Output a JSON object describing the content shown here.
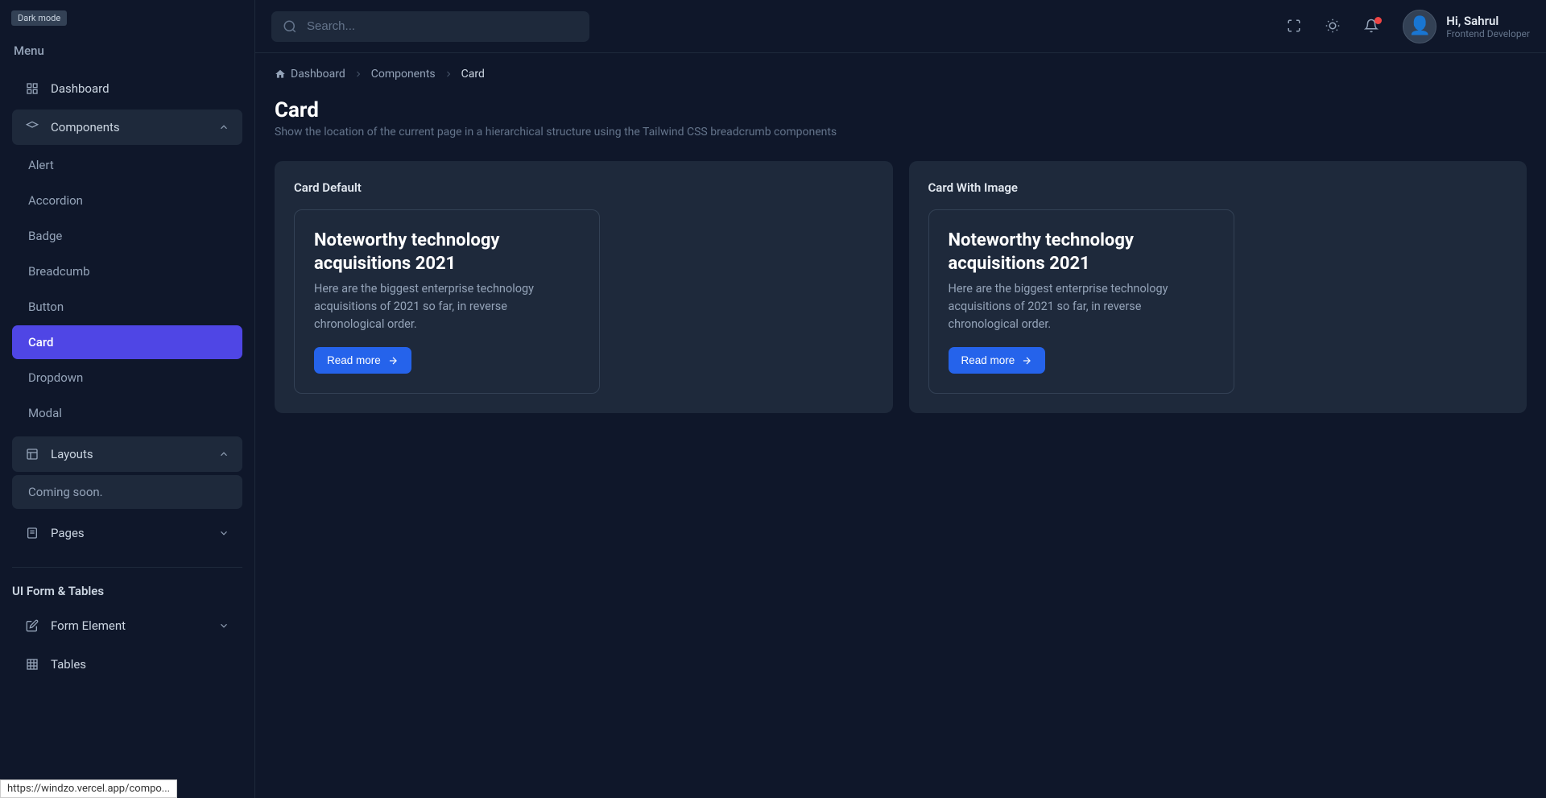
{
  "darkModeBadge": "Dark mode",
  "sidebar": {
    "menuLabel": "Menu",
    "items": {
      "dashboard": "Dashboard",
      "components": "Components",
      "layouts": "Layouts",
      "layoutsPlaceholder": "Coming soon.",
      "pages": "Pages"
    },
    "componentsSub": [
      "Alert",
      "Accordion",
      "Badge",
      "Breadcumb",
      "Button",
      "Card",
      "Dropdown",
      "Modal"
    ],
    "activeSubIndex": 5,
    "sectionFormTables": "UI Form & Tables",
    "formElement": "Form Element",
    "tables": "Tables"
  },
  "topbar": {
    "searchPlaceholder": "Search...",
    "userName": "Hi, Sahrul",
    "userRole": "Frontend Developer"
  },
  "breadcrumb": {
    "items": [
      "Dashboard",
      "Components",
      "Card"
    ]
  },
  "page": {
    "title": "Card",
    "subtitle": "Show the location of the current page in a hierarchical structure using the Tailwind CSS breadcrumb components"
  },
  "panels": {
    "left": {
      "title": "Card Default",
      "card": {
        "title": "Noteworthy technology acquisitions 2021",
        "text": "Here are the biggest enterprise technology acquisitions of 2021 so far, in reverse chronological order.",
        "button": "Read more"
      }
    },
    "right": {
      "title": "Card With Image",
      "card": {
        "title": "Noteworthy technology acquisitions 2021",
        "text": "Here are the biggest enterprise technology acquisitions of 2021 so far, in reverse chronological order.",
        "button": "Read more"
      }
    }
  },
  "statusBar": "https://windzo.vercel.app/compo..."
}
